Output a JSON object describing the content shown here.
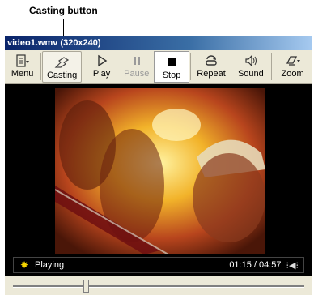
{
  "annotation": {
    "label": "Casting button"
  },
  "window": {
    "title": "video1.wmv (320x240)"
  },
  "toolbar": {
    "buttons": [
      {
        "label": "Menu",
        "icon": "menu-icon"
      },
      {
        "label": "Casting",
        "icon": "casting-icon"
      },
      {
        "label": "Play",
        "icon": "play-icon"
      },
      {
        "label": "Pause",
        "icon": "pause-icon",
        "disabled": true
      },
      {
        "label": "Stop",
        "icon": "stop-icon"
      },
      {
        "label": "Repeat",
        "icon": "repeat-icon"
      },
      {
        "label": "Sound",
        "icon": "sound-icon"
      },
      {
        "label": "Zoom",
        "icon": "zoom-icon"
      }
    ]
  },
  "status": {
    "state": "Playing",
    "time": "01:15 / 04:57",
    "volume_glyph": "⁝◀⁝"
  },
  "seek": {
    "fraction": 0.25
  },
  "colors": {
    "titlebar_start": "#0a246a",
    "toolbar_bg": "#ece9d8",
    "video_bg": "#000000",
    "status_icon": "#f5d400"
  }
}
